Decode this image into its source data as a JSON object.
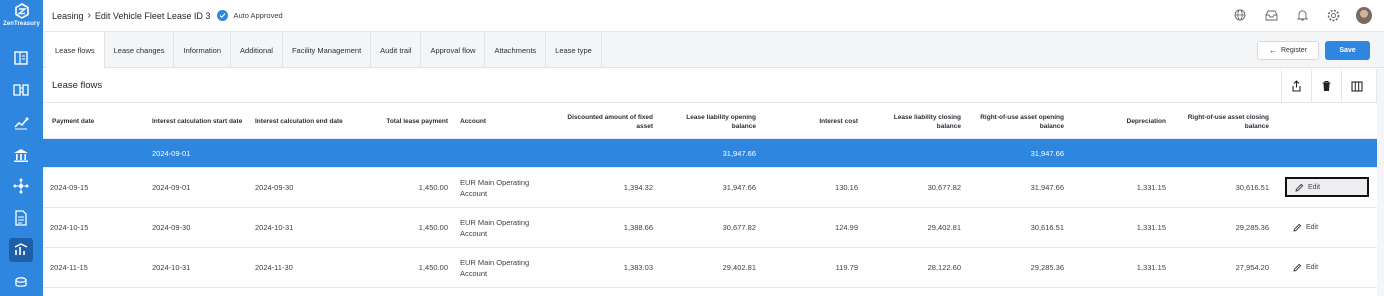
{
  "app": {
    "logo_text": "ZenTreasury"
  },
  "breadcrumb": {
    "section": "Leasing",
    "page": "Edit Vehicle Fleet Lease ID 3",
    "status": "Auto Approved"
  },
  "sidebar": {
    "items": [
      {
        "icon": "ledger-icon"
      },
      {
        "icon": "transfer-icon"
      },
      {
        "icon": "chart-icon"
      },
      {
        "icon": "bank-icon"
      },
      {
        "icon": "network-icon"
      },
      {
        "icon": "report-icon"
      },
      {
        "icon": "lease-icon",
        "active": true
      },
      {
        "icon": "coins-icon"
      }
    ]
  },
  "topbar_icons": [
    "globe-icon",
    "inbox-icon",
    "bell-icon",
    "settings-icon",
    "avatar"
  ],
  "tabs": [
    {
      "label": "Lease flows",
      "active": true
    },
    {
      "label": "Lease changes"
    },
    {
      "label": "Information"
    },
    {
      "label": "Additional"
    },
    {
      "label": "Facility Management"
    },
    {
      "label": "Audit trail"
    },
    {
      "label": "Approval flow"
    },
    {
      "label": "Attachments"
    },
    {
      "label": "Lease type"
    }
  ],
  "actions": {
    "register": "Register",
    "save": "Save"
  },
  "panel": {
    "title": "Lease flows"
  },
  "table": {
    "columns": [
      "Payment date",
      "Interest calculation start date",
      "Interest calculation end date",
      "Total lease payment",
      "Account",
      "Discounted amount of fixed asset",
      "Lease liability opening balance",
      "Interest cost",
      "Lease liability closing balance",
      "Right-of-use asset opening balance",
      "Depreciation",
      "Right-of-use asset closing balance"
    ],
    "rows": [
      {
        "selected": true,
        "cells": [
          "",
          "2024-09-01",
          "",
          "",
          "",
          "",
          "31,947.66",
          "",
          "",
          "31,947.66",
          "",
          ""
        ]
      },
      {
        "cells": [
          "2024-09-15",
          "2024-09-01",
          "2024-09-30",
          "1,450.00",
          "EUR Main Operating Account",
          "1,394.32",
          "31,947.66",
          "130.16",
          "30,677.82",
          "31,947.66",
          "1,331.15",
          "30,616.51"
        ],
        "edit": "Edit"
      },
      {
        "cells": [
          "2024-10-15",
          "2024-09-30",
          "2024-10-31",
          "1,450.00",
          "EUR Main Operating Account",
          "1,388.66",
          "30,677.82",
          "124.99",
          "29,402.81",
          "30,616.51",
          "1,331.15",
          "29,285.36"
        ],
        "edit": "Edit"
      },
      {
        "cells": [
          "2024-11-15",
          "2024-10-31",
          "2024-11-30",
          "1,450.00",
          "EUR Main Operating Account",
          "1,383.03",
          "29,402.81",
          "119.79",
          "28,122.60",
          "29,285.36",
          "1,331.15",
          "27,954.20"
        ],
        "edit": "Edit"
      }
    ]
  },
  "colors": {
    "brand": "#2e86de",
    "selected_row": "#2e86de"
  }
}
